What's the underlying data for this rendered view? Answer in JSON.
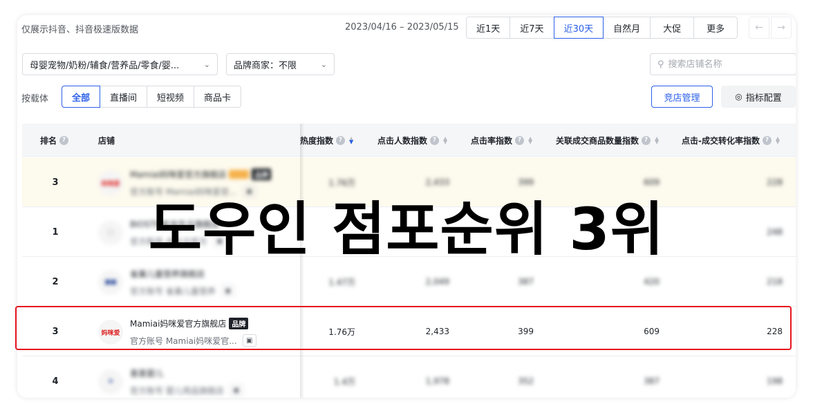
{
  "header": {
    "note": "仅展示抖音、抖音极速版数据",
    "date_range": "2023/04/16 – 2023/05/15",
    "range_tabs": [
      "近1天",
      "近7天",
      "近30天",
      "自然月",
      "大促",
      "更多"
    ],
    "active_range": "近30天"
  },
  "filters": {
    "category": "母婴宠物/奶粉/辅食/营养品/零食/婴...",
    "brand": "品牌商家：不限",
    "search_placeholder": "搜索店铺名称"
  },
  "carrier": {
    "label": "按载体",
    "tabs": [
      "全部",
      "直播间",
      "短视频",
      "商品卡"
    ],
    "active": "全部",
    "manage_button": "竞店管理",
    "config_button": "指标配置"
  },
  "table": {
    "columns": {
      "rank": "排名",
      "shop": "店铺",
      "heat": "热度指数",
      "clicks": "点击人数指数",
      "ctr": "点击率指数",
      "related": "关联成交商品数量指数",
      "conversion": "点击-成交转化率指数"
    },
    "rows": [
      {
        "rank": "3",
        "name": "Mamiai妈咪爱官方旗舰店",
        "badge": "品牌",
        "sub": "官方账号 Mamiai妈咪爱官...",
        "heat": "1.76万",
        "clicks": "2,433",
        "ctr": "399",
        "related": "609",
        "conversion": "228",
        "logo": "妈咪爱"
      },
      {
        "rank": "1",
        "name": "BIOSTIME合生元旗舰店",
        "badge": "",
        "sub": "官方账号 合生元官方",
        "heat": "",
        "clicks": "",
        "ctr": "",
        "related": "",
        "conversion": "248",
        "logo": ""
      },
      {
        "rank": "2",
        "name": "雀巢儿童营养旗舰店",
        "badge": "",
        "sub": "官方账号 雀巢儿童营养",
        "heat": "1.47万",
        "clicks": "2,049",
        "ctr": "387",
        "related": "420",
        "conversion": "218",
        "logo": ""
      },
      {
        "rank": "3",
        "name": "Mamiai妈咪爱官方旗舰店",
        "badge": "品牌",
        "sub": "官方账号 Mamiai妈咪爱官...",
        "heat": "1.76万",
        "clicks": "2,433",
        "ctr": "399",
        "related": "609",
        "conversion": "228",
        "logo": "妈咪爱"
      },
      {
        "rank": "4",
        "name": "喜喜婴儿",
        "badge": "",
        "sub": "官方账号 婴儿用品旗舰店",
        "heat": "1.4万",
        "clicks": "1,978",
        "ctr": "352",
        "related": "387",
        "conversion": "198",
        "logo": ""
      }
    ]
  },
  "overlay": {
    "title": "도우인 점포순위 3위"
  },
  "colors": {
    "accent": "#2b5fe8",
    "highlight_row": "#fdfaee",
    "red_box": "#e5141d"
  }
}
